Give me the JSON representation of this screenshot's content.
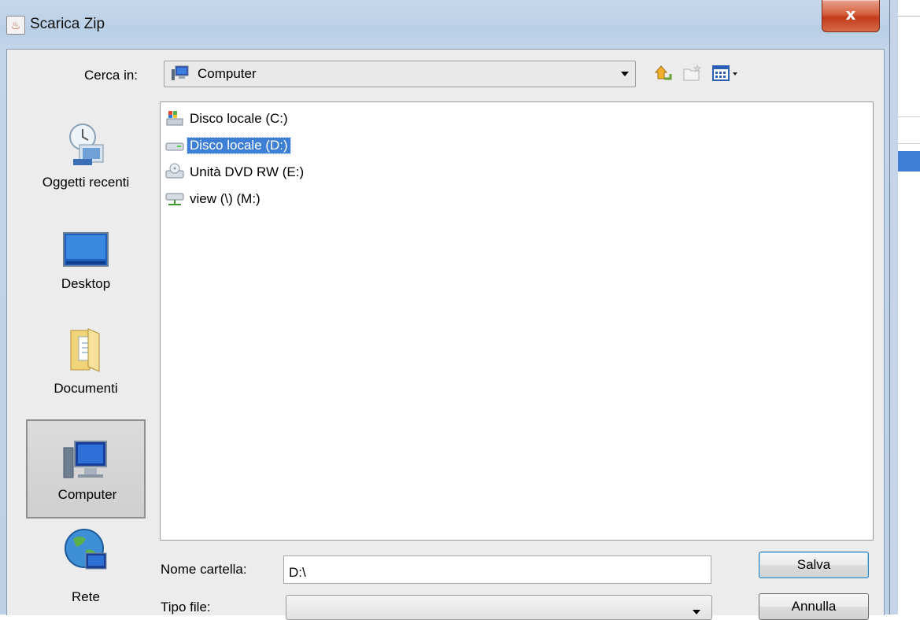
{
  "window": {
    "title": "Scarica Zip",
    "close_label": "x"
  },
  "lookin": {
    "label": "Cerca in:",
    "value": "Computer"
  },
  "places": [
    {
      "label": "Oggetti recenti",
      "icon": "recent-items-icon"
    },
    {
      "label": "Desktop",
      "icon": "desktop-icon"
    },
    {
      "label": "Documenti",
      "icon": "documents-folder-icon"
    },
    {
      "label": "Computer",
      "icon": "computer-icon",
      "selected": true
    },
    {
      "label": "Rete",
      "icon": "network-globe-icon"
    }
  ],
  "files": [
    {
      "name": "Disco locale (C:)",
      "icon": "windows-drive-icon"
    },
    {
      "name": "Disco locale (D:)",
      "icon": "hard-drive-icon",
      "selected": true
    },
    {
      "name": "Unità DVD RW (E:)",
      "icon": "dvd-drive-icon"
    },
    {
      "name": "view (\\) (M:)",
      "icon": "network-drive-icon"
    }
  ],
  "form": {
    "name_label": "Nome cartella:",
    "name_value": "D:\\",
    "type_label": "Tipo file:",
    "type_value": ""
  },
  "buttons": {
    "save": "Salva",
    "cancel": "Annulla"
  },
  "colors": {
    "selection": "#3d7fd4",
    "close": "#c9452a",
    "frame": "#c2d5ea"
  }
}
